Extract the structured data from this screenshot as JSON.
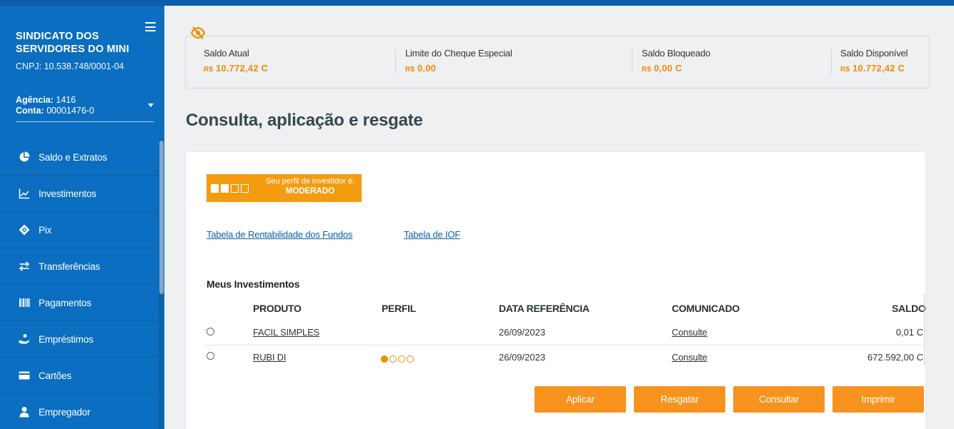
{
  "sidebar": {
    "org_name": "SINDICATO DOS SERVIDORES DO MINI",
    "cnpj": "CNPJ: 10.538.748/0001-04",
    "agencia_label": "Agência:",
    "agencia_value": "1416",
    "conta_label": "Conta:",
    "conta_value": "00001476-0",
    "items": [
      {
        "label": "Saldo e Extratos",
        "icon": "pie-chart-icon"
      },
      {
        "label": "Investimentos",
        "icon": "line-chart-icon"
      },
      {
        "label": "Pix",
        "icon": "pix-icon"
      },
      {
        "label": "Transferências",
        "icon": "transfer-icon"
      },
      {
        "label": "Pagamentos",
        "icon": "barcode-icon"
      },
      {
        "label": "Empréstimos",
        "icon": "loan-icon"
      },
      {
        "label": "Cartões",
        "icon": "card-icon"
      },
      {
        "label": "Empregador",
        "icon": "employer-icon"
      }
    ]
  },
  "balance": {
    "saldo_atual_label": "Saldo Atual",
    "saldo_atual_currency": "R$",
    "saldo_atual_value": "10.772,42 C",
    "limite_label": "Limite do Cheque Especial",
    "limite_currency": "R$",
    "limite_value": "0,00",
    "bloqueado_label": "Saldo Bloqueado",
    "bloqueado_currency": "R$",
    "bloqueado_value": "0,00 C",
    "disponivel_label": "Saldo Disponível",
    "disponivel_currency": "R$",
    "disponivel_value": "10.772,42 C"
  },
  "page_title": "Consulta, aplicação e resgate",
  "profile": {
    "text": "Seu perfil de investidor é:",
    "level": "MODERADO",
    "level_filled_boxes": 2,
    "total_boxes": 4
  },
  "links": {
    "rentabilidade": "Tabela de Rentabilidade dos Fundos",
    "iof": "Tabela de IOF"
  },
  "investments": {
    "title": "Meus Investimentos",
    "headers": {
      "produto": "PRODUTO",
      "perfil": "PERFIL",
      "data": "DATA REFERÊNCIA",
      "comunicado": "COMUNICADO",
      "saldo": "SALDO"
    },
    "rows": [
      {
        "produto": "FACIL SIMPLES",
        "perfil_level": 0,
        "data": "26/09/2023",
        "comunicado": "Consulte",
        "saldo": "0,01 C"
      },
      {
        "produto": "RUBI DI",
        "perfil_level": 1,
        "data": "26/09/2023",
        "comunicado": "Consulte",
        "saldo": "672.592,00 C"
      }
    ]
  },
  "buttons": {
    "aplicar": "Aplicar",
    "resgatar": "Resgatar",
    "consultar": "Consultar",
    "imprimir": "Imprimir"
  },
  "colors": {
    "sidebar": "#0b6ec0",
    "accent": "#f7931e",
    "link": "#0b5fa8",
    "title": "#37474f"
  }
}
